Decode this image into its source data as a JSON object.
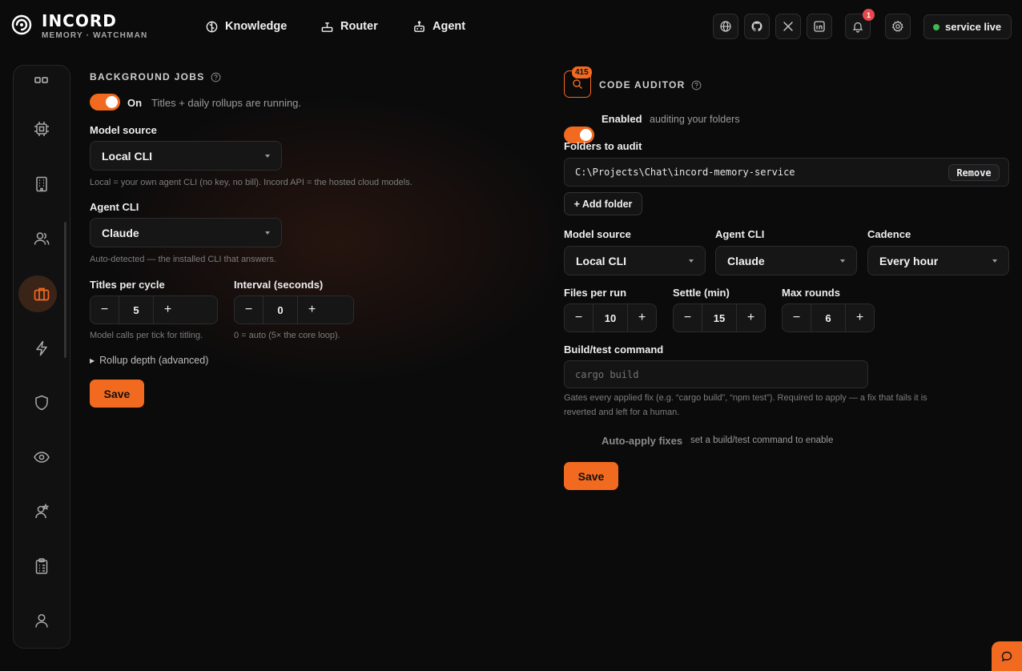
{
  "brand": {
    "title": "INCORD",
    "subtitle": "MEMORY · WATCHMAN"
  },
  "nav": [
    {
      "label": "Knowledge",
      "icon": "brain-icon"
    },
    {
      "label": "Router",
      "icon": "router-icon"
    },
    {
      "label": "Agent",
      "icon": "robot-icon"
    }
  ],
  "header": {
    "icons": [
      "globe-icon",
      "github-icon",
      "x-icon",
      "linkedin-icon"
    ],
    "notification_count": "1",
    "service_status": "service live"
  },
  "sidebar": {
    "icons": [
      "grid-icon",
      "chip-icon",
      "building-icon",
      "users-icon",
      "briefcase-icon",
      "bolt-icon",
      "shield-icon",
      "eye-icon",
      "user-star-icon",
      "clipboard-icon",
      "profile-icon"
    ],
    "active": "briefcase-icon"
  },
  "background_jobs": {
    "title": "BACKGROUND JOBS",
    "toggle_state": "On",
    "toggle_desc": "Titles + daily rollups are running.",
    "model_source_label": "Model source",
    "model_source_value": "Local CLI",
    "model_source_hint": "Local = your own agent CLI (no key, no bill). Incord API = the hosted cloud models.",
    "agent_cli_label": "Agent CLI",
    "agent_cli_value": "Claude",
    "agent_cli_hint": "Auto-detected — the installed CLI that answers.",
    "titles_label": "Titles per cycle",
    "titles_value": "5",
    "titles_hint": "Model calls per tick for titling.",
    "interval_label": "Interval (seconds)",
    "interval_value": "0",
    "interval_hint": "0 = auto (5× the core loop).",
    "rollup_label": "Rollup depth (advanced)",
    "save_label": "Save"
  },
  "code_auditor": {
    "badge_count": "415",
    "title": "CODE AUDITOR",
    "toggle_state": "Enabled",
    "toggle_desc": "auditing your folders",
    "folders_label": "Folders to audit",
    "folder_path": "C:\\Projects\\Chat\\incord-memory-service",
    "remove_label": "Remove",
    "add_folder_label": "+ Add folder",
    "model_source_label": "Model source",
    "model_source_value": "Local CLI",
    "agent_cli_label": "Agent CLI",
    "agent_cli_value": "Claude",
    "cadence_label": "Cadence",
    "cadence_value": "Every hour",
    "files_label": "Files per run",
    "files_value": "10",
    "settle_label": "Settle (min)",
    "settle_value": "15",
    "rounds_label": "Max rounds",
    "rounds_value": "6",
    "build_label": "Build/test command",
    "build_placeholder": "cargo build",
    "build_hint_1": "Gates every applied fix (e.g. “cargo build”, “npm test”). Required to apply — a fix that fails it is",
    "build_hint_2": "reverted and left for a human.",
    "auto_apply_label": "Auto-apply fixes",
    "auto_apply_hint": "set a build/test command to enable",
    "save_label": "Save"
  },
  "colors": {
    "accent": "#f26a1f",
    "status_green": "#3fb950",
    "badge_red": "#e5484d"
  }
}
